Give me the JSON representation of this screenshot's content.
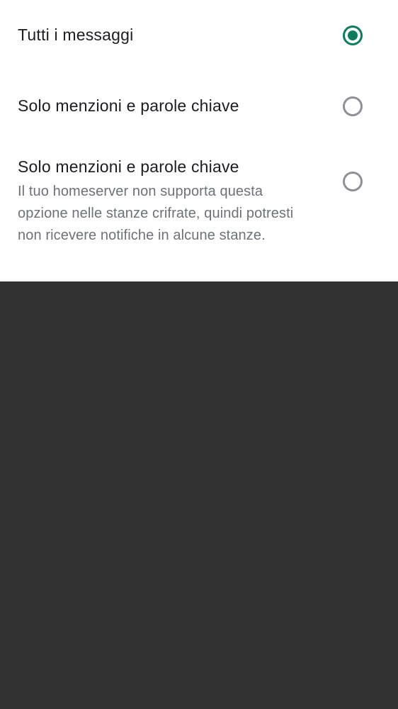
{
  "options": [
    {
      "label": "Tutti i messaggi",
      "selected": true
    },
    {
      "label": "Solo menzioni e parole chiave",
      "selected": false
    },
    {
      "label": "Solo menzioni e parole chiave",
      "description": "Il tuo homeserver non supporta questa opzione nelle stanze crifrate, quindi potresti non ricevere notifiche in alcune stanze.",
      "selected": false
    }
  ],
  "colors": {
    "accent": "#0c7d5f",
    "radio_unselected": "#8d9097",
    "primary_text": "#1b1d22",
    "secondary_text": "#6e7179",
    "scrim": "#323232"
  }
}
